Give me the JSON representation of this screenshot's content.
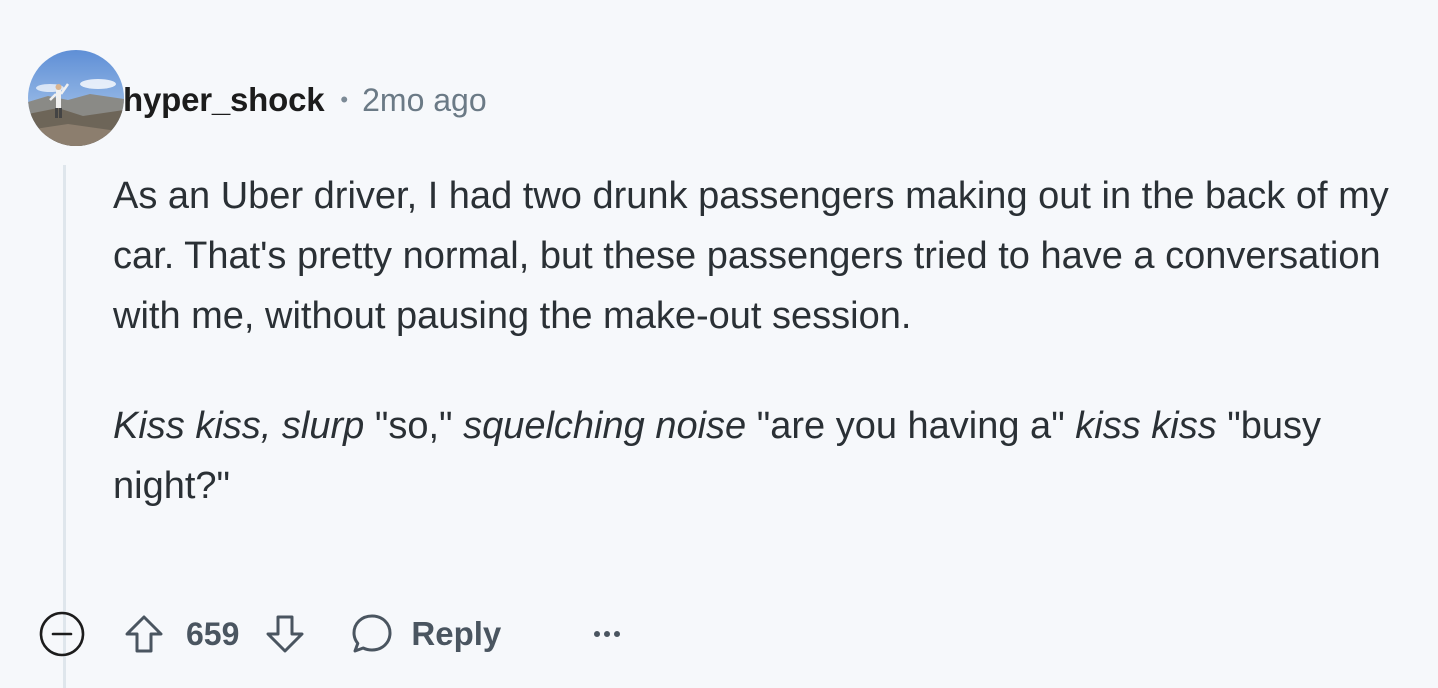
{
  "comment": {
    "author": "hyper_shock",
    "separator": "•",
    "timestamp": "2mo ago",
    "paragraph1": "As an Uber driver, I had two drunk passengers making out in the back of my car. That's pretty normal, but these passengers tried to have a conversation with me, without pausing the make-out session.",
    "paragraph2": {
      "s1": "Kiss kiss, slurp",
      "s2": " \"so,\" ",
      "s3": "squelching noise",
      "s4": " \"are you having a\" ",
      "s5": "kiss kiss",
      "s6": " \"busy night?\""
    }
  },
  "actions": {
    "vote_count": "659",
    "reply_label": "Reply"
  },
  "icons": {
    "collapse": "minus-circle-icon",
    "upvote": "arrow-up-icon",
    "downvote": "arrow-down-icon",
    "reply": "speech-bubble-icon",
    "more": "ellipsis-icon"
  },
  "colors": {
    "background": "#f6f8fb",
    "text": "#2a3035",
    "muted": "#6b7a86",
    "thread_line": "#dfe6ec"
  }
}
